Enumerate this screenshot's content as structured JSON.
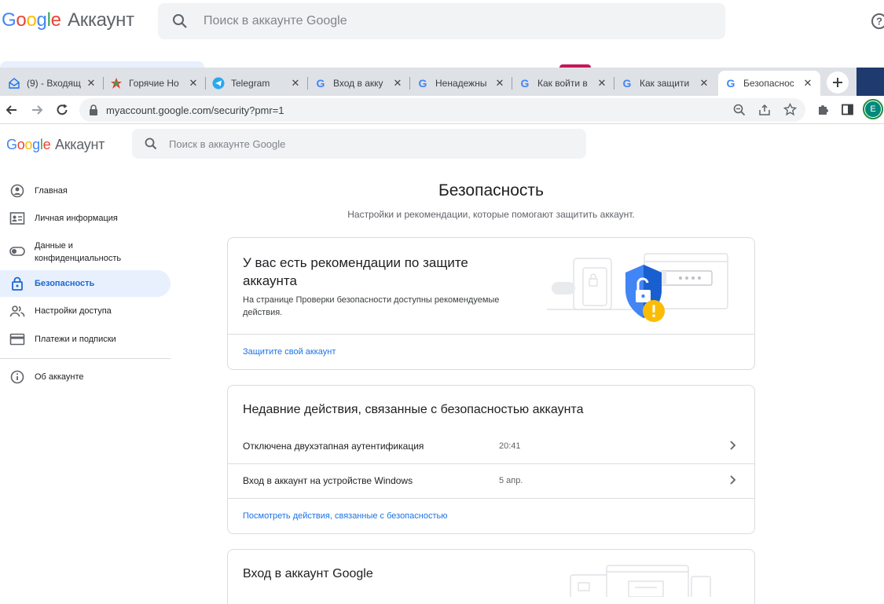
{
  "outer": {
    "logo_google": [
      "G",
      "o",
      "o",
      "g",
      "l",
      "e"
    ],
    "logo_suffix": "Аккаунт",
    "search_placeholder": "Поиск в аккаунте Google",
    "help_icon": "help-icon"
  },
  "tabs": [
    {
      "title": "(9) - Входящ",
      "icon": "mail-icon"
    },
    {
      "title": "Горячие Но",
      "icon": "news-icon"
    },
    {
      "title": "Telegram",
      "icon": "telegram-icon"
    },
    {
      "title": "Вход в акку",
      "icon": "google-icon"
    },
    {
      "title": "Ненадежны",
      "icon": "google-icon"
    },
    {
      "title": "Как войти в",
      "icon": "google-icon"
    },
    {
      "title": "Как защити",
      "icon": "google-icon"
    },
    {
      "title": "Безопаснос",
      "icon": "google-icon",
      "active": true
    }
  ],
  "toolbar": {
    "url": "myaccount.google.com/security?pmr=1",
    "profile_initial": "E"
  },
  "inner": {
    "logo_suffix": "Аккаунт",
    "search_placeholder": "Поиск в аккаунте Google"
  },
  "sidebar": {
    "items": [
      {
        "label": "Главная",
        "icon": "home-icon"
      },
      {
        "label": "Личная информация",
        "icon": "id-card-icon"
      },
      {
        "label": "Данные и\nконфиденциальность",
        "icon": "toggle-icon"
      },
      {
        "label": "Безопасность",
        "icon": "lock-icon",
        "active": true
      },
      {
        "label": "Настройки доступа",
        "icon": "people-icon"
      },
      {
        "label": "Платежи и подписки",
        "icon": "card-icon"
      },
      {
        "label": "Об аккаунте",
        "icon": "info-icon"
      }
    ]
  },
  "main": {
    "title": "Безопасность",
    "subtitle": "Настройки и рекомендации, которые помогают защитить аккаунт.",
    "recommend_card": {
      "title": "У вас есть рекомендации по защите аккаунта",
      "description": "На странице Проверки безопасности доступны рекомендуемые действия.",
      "link": "Защитите свой аккаунт"
    },
    "activity_card": {
      "title": "Недавние действия, связанные с безопасностью аккаунта",
      "rows": [
        {
          "text": "Отключена двухэтапная аутентификация",
          "time": "20:41"
        },
        {
          "text": "Вход в аккаунт на устройстве Windows",
          "time": "5 апр."
        }
      ],
      "link": "Посмотреть действия, связанные с безопасностью"
    },
    "signin_card": {
      "title": "Вход в аккаунт Google"
    }
  },
  "colors": {
    "accent": "#1a73e8",
    "active_bg": "#e8f0fe",
    "shield": "#4285F4",
    "warning": "#FBBC05"
  }
}
